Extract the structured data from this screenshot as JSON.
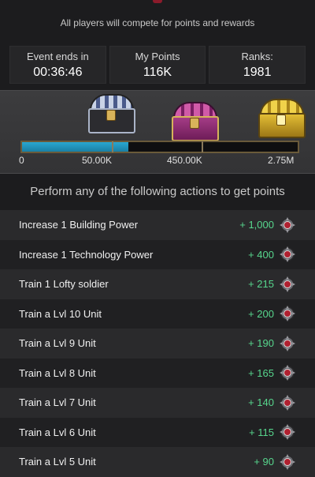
{
  "header": {
    "subtitle": "All players will compete for points and rewards"
  },
  "stats": [
    {
      "label": "Event ends in",
      "value": "00:36:46"
    },
    {
      "label": "My Points",
      "value": "116K"
    },
    {
      "label": "Ranks:",
      "value": "1981"
    }
  ],
  "rewards": {
    "progress_fraction": 0.385,
    "markers": [
      "0",
      "50.00K",
      "450.00K",
      "2.75M"
    ],
    "chests": [
      {
        "icon": "silver-chest-icon",
        "color": "#9aa9c4"
      },
      {
        "icon": "purple-chest-icon",
        "color": "#b0408f"
      },
      {
        "icon": "gold-chest-icon",
        "color": "#d8b835"
      }
    ]
  },
  "actions": {
    "heading": "Perform any of the following actions to get points",
    "items": [
      {
        "label": "Increase 1 Building Power",
        "points": "+ 1,000"
      },
      {
        "label": "Increase 1 Technology Power",
        "points": "+ 400"
      },
      {
        "label": "Train 1 Lofty soldier",
        "points": "+ 215"
      },
      {
        "label": "Train a Lvl 10 Unit",
        "points": "+ 200"
      },
      {
        "label": "Train a Lvl 9 Unit",
        "points": "+ 190"
      },
      {
        "label": "Train a Lvl 8 Unit",
        "points": "+ 165"
      },
      {
        "label": "Train a Lvl 7 Unit",
        "points": "+ 140"
      },
      {
        "label": "Train a Lvl 6 Unit",
        "points": "+ 115"
      },
      {
        "label": "Train a Lvl 5 Unit",
        "points": "+ 90"
      }
    ]
  }
}
